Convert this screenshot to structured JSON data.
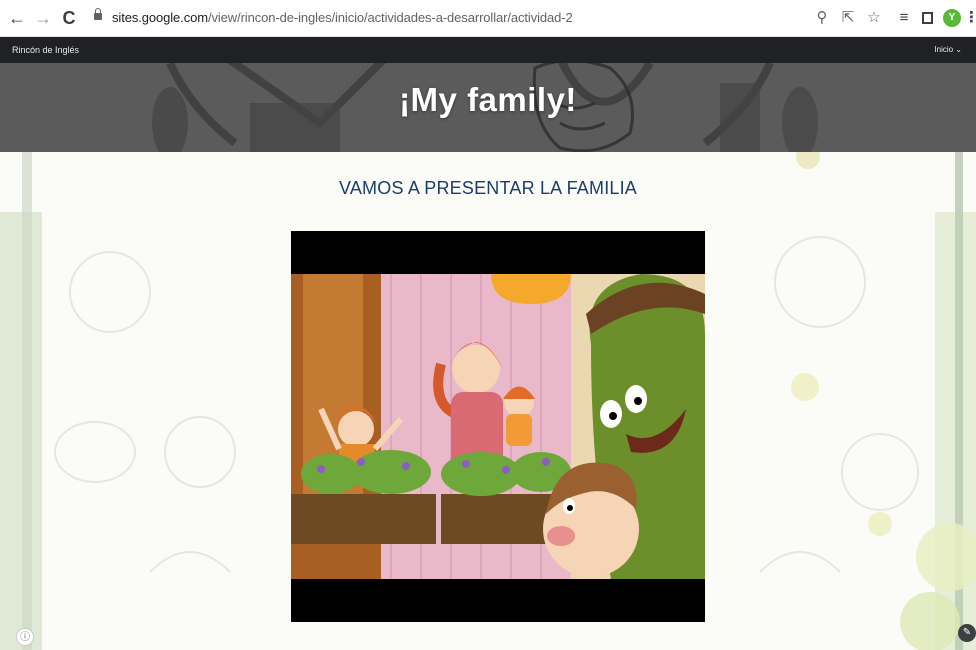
{
  "browser": {
    "url_host": "sites.google.com",
    "url_path": "/view/rincon-de-ingles/inicio/actividades-a-desarrollar/actividad-2",
    "profile_initial": "Y",
    "icons": [
      "back-arrow-icon",
      "forward-arrow-icon",
      "reload-icon",
      "lock-icon",
      "zoom-icon",
      "share-icon",
      "bookmark-star-icon",
      "reading-list-icon",
      "side-panel-icon",
      "profile-avatar",
      "kebab-menu-icon"
    ]
  },
  "site": {
    "name": "Rincón de Inglés",
    "nav_label": "Inicio ⌄"
  },
  "page": {
    "title": "¡My family!",
    "section_heading": "VAMOS A PRESENTAR LA FAMILIA"
  },
  "video": {
    "description_icon": "embedded-video-player"
  },
  "colors": {
    "site_bar": "#202124",
    "banner": "#5b5b5b",
    "heading": "#1d3d6e",
    "profile": "#58b936"
  }
}
